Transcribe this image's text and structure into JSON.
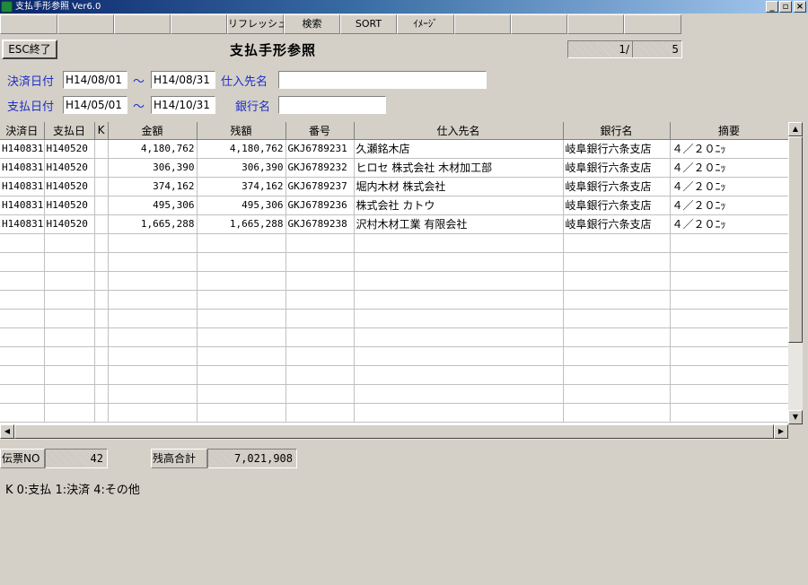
{
  "window": {
    "title": "支払手形参照 Ver6.0",
    "buttons": [
      "_",
      "▫",
      "×"
    ]
  },
  "fkeys": [
    "リフレッシュ",
    "検索",
    "SORT",
    "ｲﾒｰｼﾞ"
  ],
  "header": {
    "esc_label": "ESC終了",
    "title": "支払手形参照",
    "page_current": "1/",
    "page_total": "5"
  },
  "filters": {
    "settle_date_label": "決済日付",
    "settle_date_from": "H14/08/01",
    "settle_date_to": "H14/08/31",
    "pay_date_label": "支払日付",
    "pay_date_from": "H14/05/01",
    "pay_date_to": "H14/10/31",
    "tilde": "～",
    "supplier_label": "仕入先名",
    "supplier_value": "",
    "bank_label": "銀行名",
    "bank_value": ""
  },
  "table": {
    "columns": [
      "決済日",
      "支払日",
      "K",
      "金額",
      "残額",
      "番号",
      "仕入先名",
      "銀行名",
      "摘要"
    ],
    "rows": [
      [
        "H140831",
        "H140520",
        "",
        "4,180,762",
        "4,180,762",
        "GKJ6789231",
        "久瀬銘木店",
        "岐阜銀行六条支店",
        "４／２０ﾆｯ"
      ],
      [
        "H140831",
        "H140520",
        "",
        "306,390",
        "306,390",
        "GKJ6789232",
        "ヒロセ 株式会社 木材加工部",
        "岐阜銀行六条支店",
        "４／２０ﾆｯ"
      ],
      [
        "H140831",
        "H140520",
        "",
        "374,162",
        "374,162",
        "GKJ6789237",
        "堀内木材 株式会社",
        "岐阜銀行六条支店",
        "４／２０ﾆｯ"
      ],
      [
        "H140831",
        "H140520",
        "",
        "495,306",
        "495,306",
        "GKJ6789236",
        "株式会社 カトウ",
        "岐阜銀行六条支店",
        "４／２０ﾆｯ"
      ],
      [
        "H140831",
        "H140520",
        "",
        "1,665,288",
        "1,665,288",
        "GKJ6789238",
        "沢村木材工業 有限会社",
        "岐阜銀行六条支店",
        "４／２０ﾆｯ"
      ]
    ]
  },
  "footer": {
    "slip_label": "伝票NO",
    "slip_value": "42",
    "balance_label": "残高合計",
    "balance_value": "7,021,908",
    "legend": "K  0:支払 1:決済 4:その他"
  },
  "scroll": {
    "up": "▲",
    "down": "▼",
    "left": "◀",
    "right": "▶"
  }
}
